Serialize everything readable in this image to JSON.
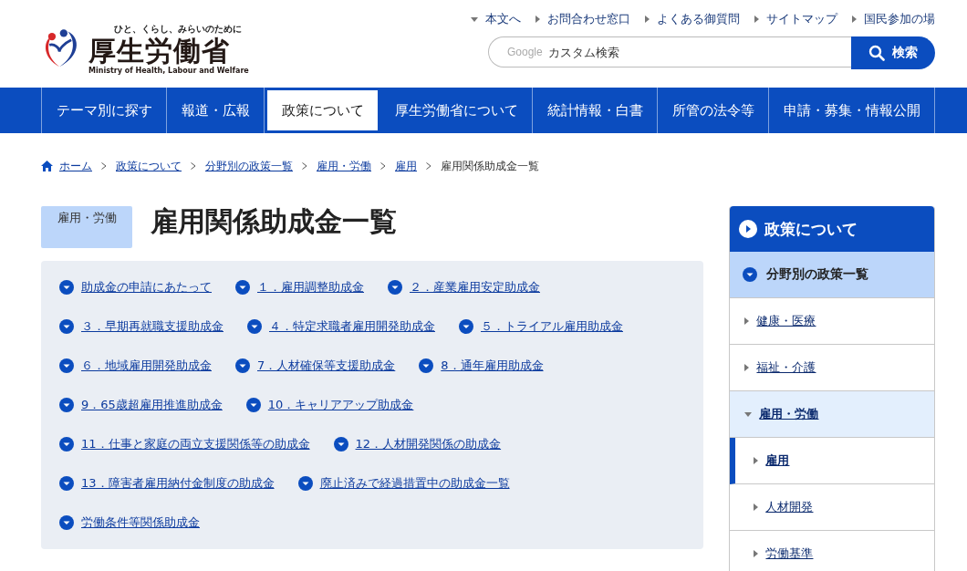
{
  "header": {
    "tagline": "ひと、くらし、みらいのために",
    "site_name": "厚生労働省",
    "site_name_en": "Ministry of Health, Labour and Welfare",
    "utility_links": [
      {
        "label": "本文へ",
        "kind": "down"
      },
      {
        "label": "お問合わせ窓口",
        "kind": "right"
      },
      {
        "label": "よくある御質問",
        "kind": "right"
      },
      {
        "label": "サイトマップ",
        "kind": "right"
      },
      {
        "label": "国民参加の場",
        "kind": "right"
      }
    ],
    "search": {
      "brand": "Google",
      "placeholder": "カスタム検索",
      "button": "検索"
    }
  },
  "nav": [
    {
      "label": "テーマ別に探す",
      "selected": false
    },
    {
      "label": "報道・広報",
      "selected": false
    },
    {
      "label": "政策について",
      "selected": true
    },
    {
      "label": "厚生労働省について",
      "selected": false
    },
    {
      "label": "統計情報・白書",
      "selected": false
    },
    {
      "label": "所管の法令等",
      "selected": false
    },
    {
      "label": "申請・募集・情報公開",
      "selected": false
    }
  ],
  "breadcrumb": [
    {
      "label": "ホーム",
      "kind": "home"
    },
    {
      "label": "政策について",
      "kind": "link"
    },
    {
      "label": "分野別の政策一覧",
      "kind": "link"
    },
    {
      "label": "雇用・労働",
      "kind": "link"
    },
    {
      "label": "雇用",
      "kind": "link"
    },
    {
      "label": "雇用関係助成金一覧",
      "kind": "current"
    }
  ],
  "page": {
    "category": "雇用・労働",
    "title": "雇用関係助成金一覧"
  },
  "anchor_rows": [
    [
      "助成金の申請にあたって",
      "１．雇用調整助成金",
      "２．産業雇用安定助成金"
    ],
    [
      "３．早期再就職支援助成金",
      "４．特定求職者雇用開発助成金",
      "５．トライアル雇用助成金"
    ],
    [
      "６．地域雇用開発助成金",
      "7．人材確保等支援助成金",
      "8．通年雇用助成金"
    ],
    [
      "9．65歳超雇用推進助成金",
      "10．キャリアアップ助成金"
    ],
    [
      "11．仕事と家庭の両立支援関係等の助成金",
      "12．人材開発関係の助成金"
    ],
    [
      "13．障害者雇用納付金制度の助成金",
      "廃止済みで経過措置中の助成金一覧"
    ],
    [
      "労働条件等関係助成金"
    ]
  ],
  "sidebar": {
    "title": "政策について",
    "section": "分野別の政策一覧",
    "items": [
      {
        "label": "健康・医療",
        "expanded": false
      },
      {
        "label": "福祉・介護",
        "expanded": false
      },
      {
        "label": "雇用・労働",
        "expanded": true,
        "children": [
          {
            "label": "雇用",
            "selected": true
          },
          {
            "label": "人材開発",
            "selected": false
          },
          {
            "label": "労働基準",
            "selected": false
          }
        ]
      }
    ]
  }
}
